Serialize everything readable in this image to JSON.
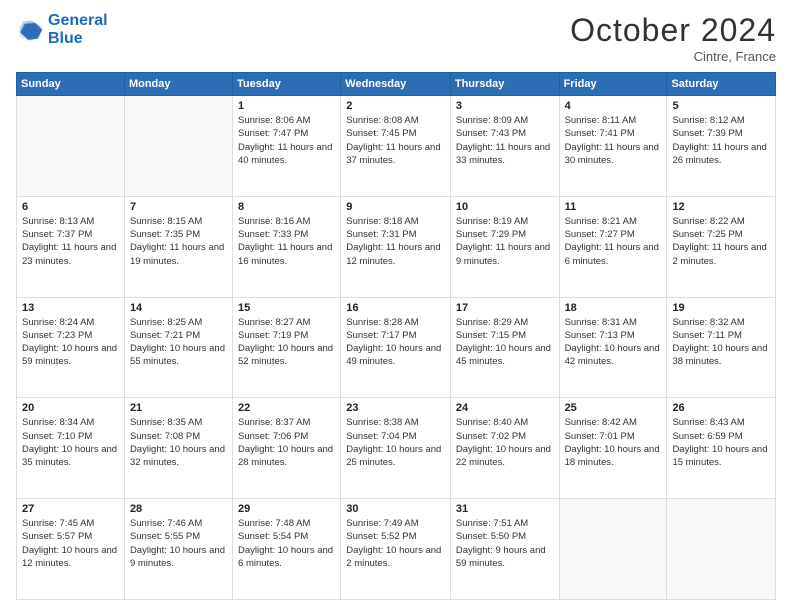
{
  "logo": {
    "line1": "General",
    "line2": "Blue"
  },
  "title": "October 2024",
  "subtitle": "Cintre, France",
  "days_header": [
    "Sunday",
    "Monday",
    "Tuesday",
    "Wednesday",
    "Thursday",
    "Friday",
    "Saturday"
  ],
  "weeks": [
    [
      {
        "day": "",
        "info": ""
      },
      {
        "day": "",
        "info": ""
      },
      {
        "day": "1",
        "info": "Sunrise: 8:06 AM\nSunset: 7:47 PM\nDaylight: 11 hours and 40 minutes."
      },
      {
        "day": "2",
        "info": "Sunrise: 8:08 AM\nSunset: 7:45 PM\nDaylight: 11 hours and 37 minutes."
      },
      {
        "day": "3",
        "info": "Sunrise: 8:09 AM\nSunset: 7:43 PM\nDaylight: 11 hours and 33 minutes."
      },
      {
        "day": "4",
        "info": "Sunrise: 8:11 AM\nSunset: 7:41 PM\nDaylight: 11 hours and 30 minutes."
      },
      {
        "day": "5",
        "info": "Sunrise: 8:12 AM\nSunset: 7:39 PM\nDaylight: 11 hours and 26 minutes."
      }
    ],
    [
      {
        "day": "6",
        "info": "Sunrise: 8:13 AM\nSunset: 7:37 PM\nDaylight: 11 hours and 23 minutes."
      },
      {
        "day": "7",
        "info": "Sunrise: 8:15 AM\nSunset: 7:35 PM\nDaylight: 11 hours and 19 minutes."
      },
      {
        "day": "8",
        "info": "Sunrise: 8:16 AM\nSunset: 7:33 PM\nDaylight: 11 hours and 16 minutes."
      },
      {
        "day": "9",
        "info": "Sunrise: 8:18 AM\nSunset: 7:31 PM\nDaylight: 11 hours and 12 minutes."
      },
      {
        "day": "10",
        "info": "Sunrise: 8:19 AM\nSunset: 7:29 PM\nDaylight: 11 hours and 9 minutes."
      },
      {
        "day": "11",
        "info": "Sunrise: 8:21 AM\nSunset: 7:27 PM\nDaylight: 11 hours and 6 minutes."
      },
      {
        "day": "12",
        "info": "Sunrise: 8:22 AM\nSunset: 7:25 PM\nDaylight: 11 hours and 2 minutes."
      }
    ],
    [
      {
        "day": "13",
        "info": "Sunrise: 8:24 AM\nSunset: 7:23 PM\nDaylight: 10 hours and 59 minutes."
      },
      {
        "day": "14",
        "info": "Sunrise: 8:25 AM\nSunset: 7:21 PM\nDaylight: 10 hours and 55 minutes."
      },
      {
        "day": "15",
        "info": "Sunrise: 8:27 AM\nSunset: 7:19 PM\nDaylight: 10 hours and 52 minutes."
      },
      {
        "day": "16",
        "info": "Sunrise: 8:28 AM\nSunset: 7:17 PM\nDaylight: 10 hours and 49 minutes."
      },
      {
        "day": "17",
        "info": "Sunrise: 8:29 AM\nSunset: 7:15 PM\nDaylight: 10 hours and 45 minutes."
      },
      {
        "day": "18",
        "info": "Sunrise: 8:31 AM\nSunset: 7:13 PM\nDaylight: 10 hours and 42 minutes."
      },
      {
        "day": "19",
        "info": "Sunrise: 8:32 AM\nSunset: 7:11 PM\nDaylight: 10 hours and 38 minutes."
      }
    ],
    [
      {
        "day": "20",
        "info": "Sunrise: 8:34 AM\nSunset: 7:10 PM\nDaylight: 10 hours and 35 minutes."
      },
      {
        "day": "21",
        "info": "Sunrise: 8:35 AM\nSunset: 7:08 PM\nDaylight: 10 hours and 32 minutes."
      },
      {
        "day": "22",
        "info": "Sunrise: 8:37 AM\nSunset: 7:06 PM\nDaylight: 10 hours and 28 minutes."
      },
      {
        "day": "23",
        "info": "Sunrise: 8:38 AM\nSunset: 7:04 PM\nDaylight: 10 hours and 25 minutes."
      },
      {
        "day": "24",
        "info": "Sunrise: 8:40 AM\nSunset: 7:02 PM\nDaylight: 10 hours and 22 minutes."
      },
      {
        "day": "25",
        "info": "Sunrise: 8:42 AM\nSunset: 7:01 PM\nDaylight: 10 hours and 18 minutes."
      },
      {
        "day": "26",
        "info": "Sunrise: 8:43 AM\nSunset: 6:59 PM\nDaylight: 10 hours and 15 minutes."
      }
    ],
    [
      {
        "day": "27",
        "info": "Sunrise: 7:45 AM\nSunset: 5:57 PM\nDaylight: 10 hours and 12 minutes."
      },
      {
        "day": "28",
        "info": "Sunrise: 7:46 AM\nSunset: 5:55 PM\nDaylight: 10 hours and 9 minutes."
      },
      {
        "day": "29",
        "info": "Sunrise: 7:48 AM\nSunset: 5:54 PM\nDaylight: 10 hours and 6 minutes."
      },
      {
        "day": "30",
        "info": "Sunrise: 7:49 AM\nSunset: 5:52 PM\nDaylight: 10 hours and 2 minutes."
      },
      {
        "day": "31",
        "info": "Sunrise: 7:51 AM\nSunset: 5:50 PM\nDaylight: 9 hours and 59 minutes."
      },
      {
        "day": "",
        "info": ""
      },
      {
        "day": "",
        "info": ""
      }
    ]
  ]
}
